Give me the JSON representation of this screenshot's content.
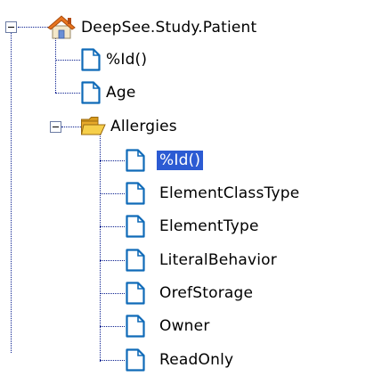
{
  "tree": {
    "root": {
      "label": "DeepSee.Study.Patient",
      "icon": "home-icon",
      "expanded": true
    },
    "children": [
      {
        "label": "%Id()",
        "icon": "document-icon"
      },
      {
        "label": "Age",
        "icon": "document-icon"
      },
      {
        "label": "Allergies",
        "icon": "folder-open-icon",
        "expanded": true,
        "children": [
          {
            "label": "%Id()",
            "icon": "document-icon",
            "selected": true
          },
          {
            "label": "ElementClassType",
            "icon": "document-icon"
          },
          {
            "label": "ElementType",
            "icon": "document-icon"
          },
          {
            "label": "LiteralBehavior",
            "icon": "document-icon"
          },
          {
            "label": "OrefStorage",
            "icon": "document-icon"
          },
          {
            "label": "Owner",
            "icon": "document-icon"
          },
          {
            "label": "ReadOnly",
            "icon": "document-icon"
          }
        ]
      }
    ]
  },
  "colors": {
    "selection": "#2c5bd3",
    "connector": "#0a1f8f",
    "folder": "#f2c23a",
    "house_roof": "#e8741e"
  }
}
